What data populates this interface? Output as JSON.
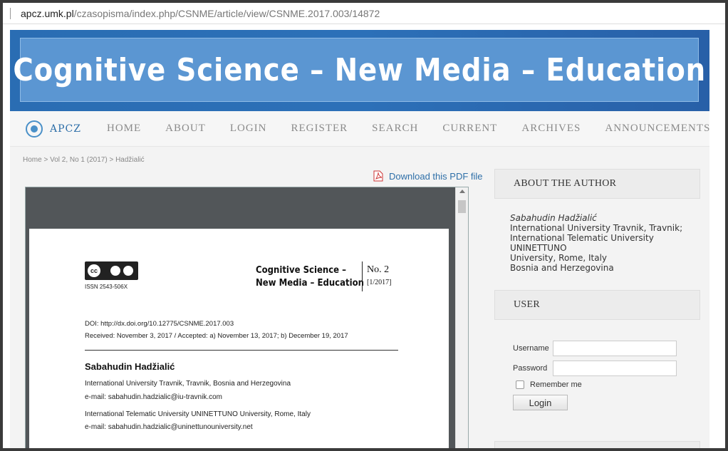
{
  "browser": {
    "url_host": "apcz.umk.pl",
    "url_path": "/czasopisma/index.php/CSNME/article/view/CSNME.2017.003/14872"
  },
  "banner": {
    "title": "Cognitive Science – New Media – Education"
  },
  "nav": {
    "logo_text": "APCZ",
    "items": [
      "HOME",
      "ABOUT",
      "LOGIN",
      "REGISTER",
      "SEARCH",
      "CURRENT",
      "ARCHIVES",
      "ANNOUNCEMENTS"
    ]
  },
  "breadcrumb": "Home > Vol 2, No 1 (2017) > Hadžialić",
  "download_label": "Download this PDF file",
  "pdf": {
    "cc_label": "cc",
    "issn": "ISSN 2543-506X",
    "journal_line1": "Cognitive Science –",
    "journal_line2": "New Media – Education",
    "issue_no": "No. 2",
    "issue_year": "[1/2017]",
    "doi": "DOI: http://dx.doi.org/10.12775/CSNME.2017.003",
    "received": "Received: November 3, 2017 / Accepted: a) November 13, 2017;  b) December 19, 2017",
    "author": "Sabahudin Hadžialić",
    "aff1": "International University Travnik, Travnik, Bosnia and Herzegovina",
    "mail1": "e-mail: sabahudin.hadzialic@iu-travnik.com",
    "aff2": "International Telematic University UNINETTUNO University, Rome, Italy",
    "mail2": "e-mail: sabahudin.hadzialic@uninettunouniversity.net"
  },
  "about_author": {
    "heading": "ABOUT THE AUTHOR",
    "name": "Sabahudin Hadžialić",
    "line1": "International University Travnik, Travnik;",
    "line2": "International Telematic University UNINETTUNO",
    "line3": "University, Rome, Italy",
    "line4": "Bosnia and Herzegovina"
  },
  "user": {
    "heading": "USER",
    "username_label": "Username",
    "password_label": "Password",
    "remember_label": "Remember me",
    "login_label": "Login"
  },
  "colors": {
    "banner": "#2c70b8",
    "banner_inner": "#5b96d2",
    "link": "#2e6fa8"
  },
  "icons": [
    "apcz-logo-icon",
    "pdf-icon",
    "creative-commons-icon"
  ]
}
